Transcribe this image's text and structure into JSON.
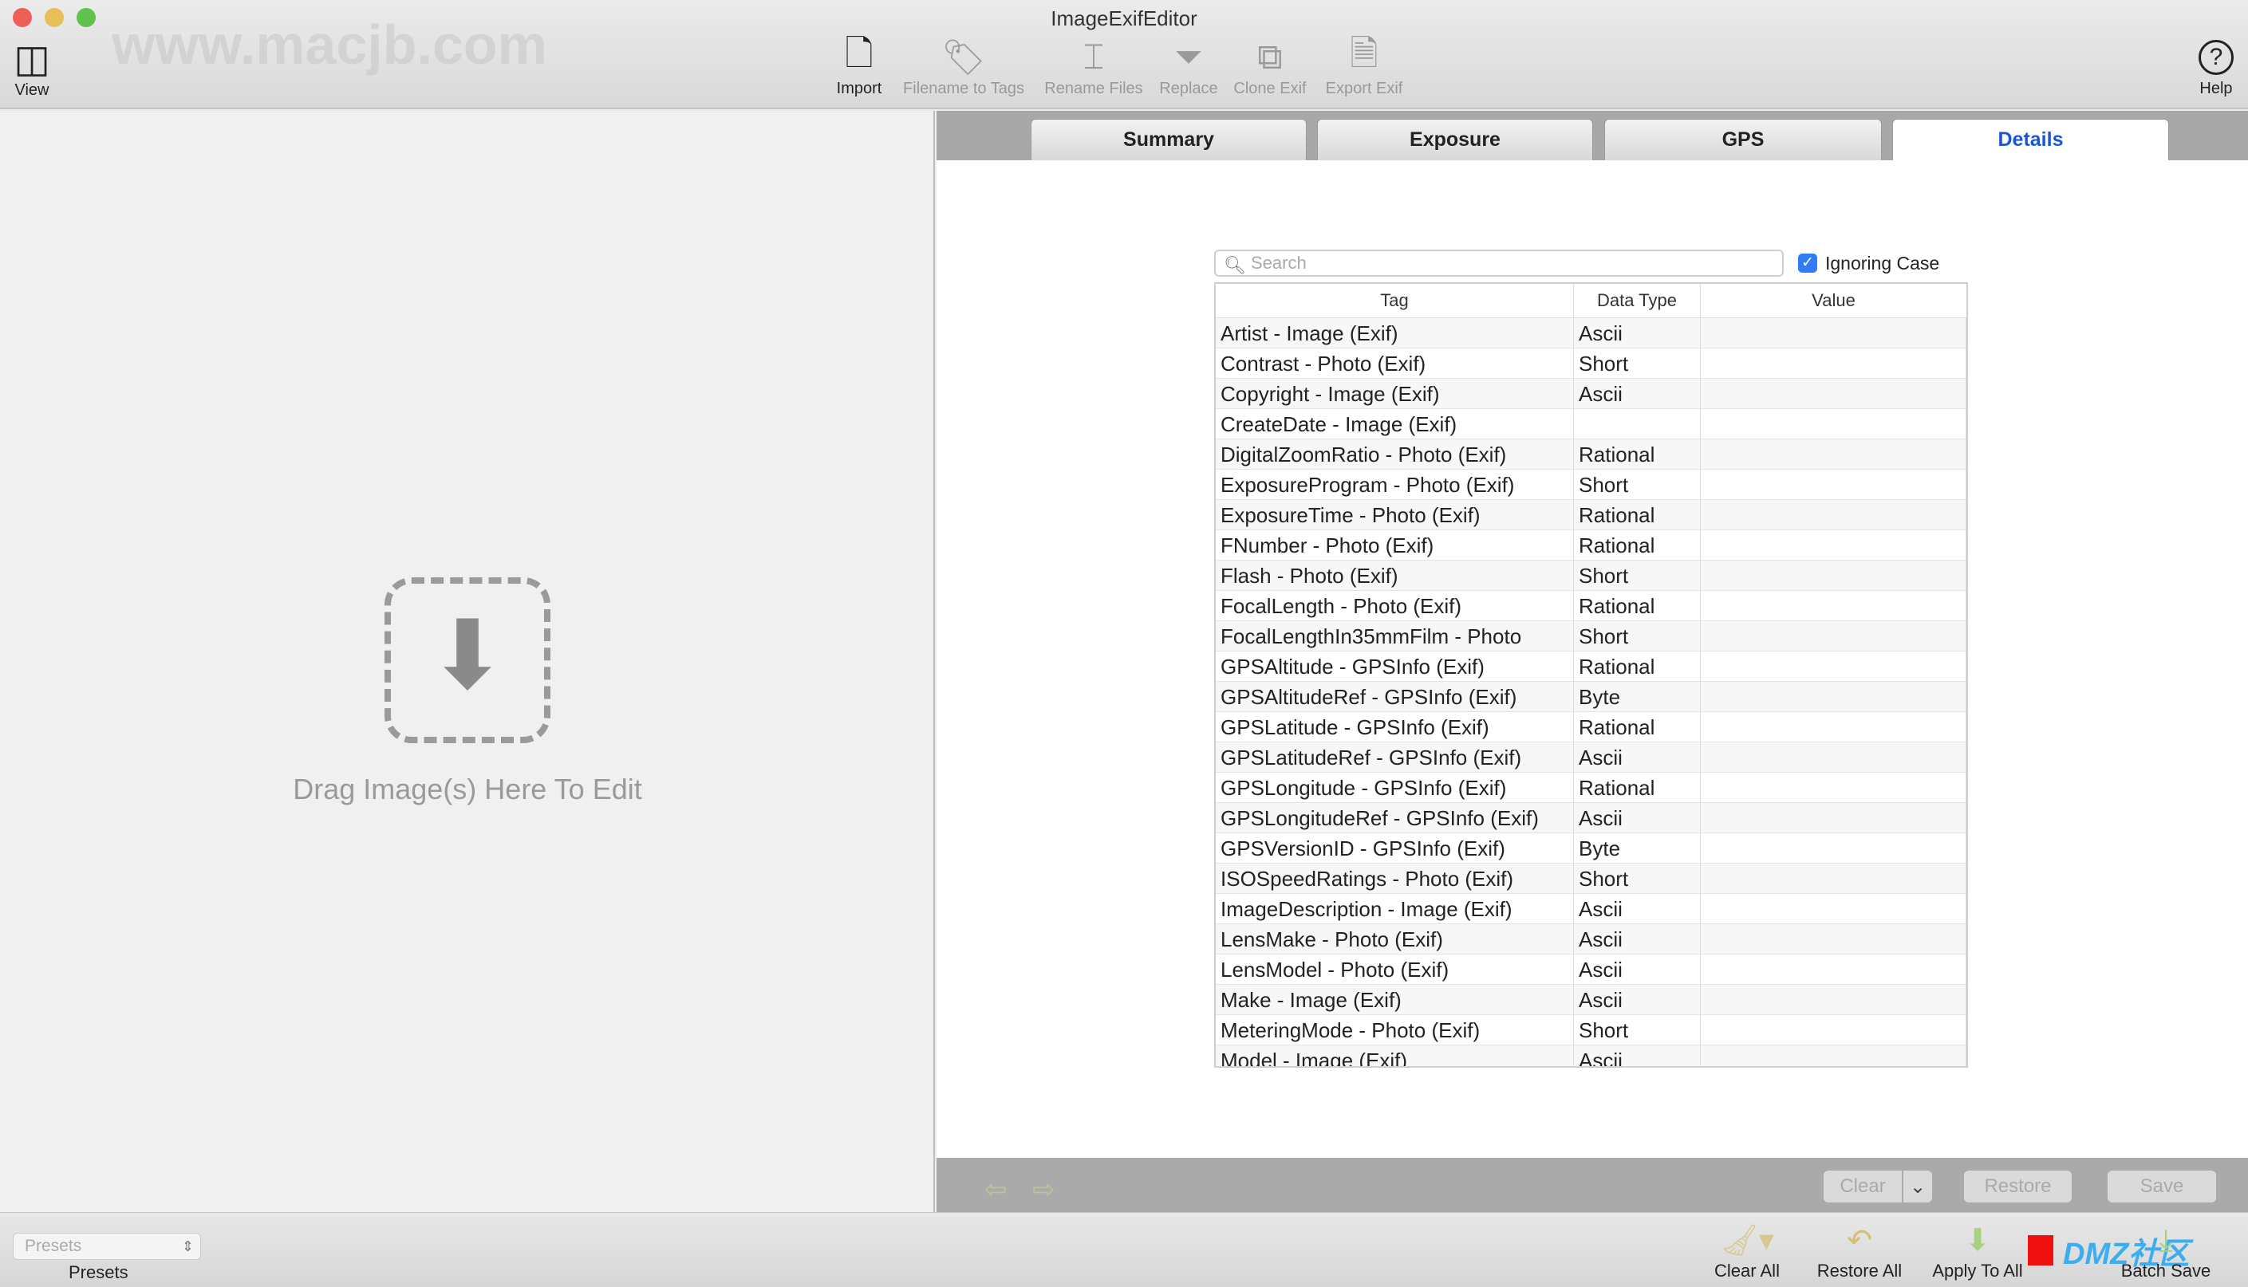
{
  "window": {
    "title": "ImageExifEditor"
  },
  "toolbar": {
    "view": "View",
    "help": "Help",
    "items": [
      {
        "label": "Import",
        "icon": "import-file-icon",
        "enabled": true
      },
      {
        "label": "Filename to Tags",
        "icon": "tag-icon",
        "enabled": false
      },
      {
        "label": "Rename Files",
        "icon": "rename-icon",
        "enabled": false
      },
      {
        "label": "Replace",
        "icon": "funnel-icon",
        "enabled": false
      },
      {
        "label": "Clone Exif",
        "icon": "clone-icon",
        "enabled": false
      },
      {
        "label": "Export Exif",
        "icon": "csv-icon",
        "enabled": false
      }
    ],
    "watermark": "www.macjb.com"
  },
  "left": {
    "drop_text": "Drag Image(s) Here To Edit"
  },
  "tabs": [
    {
      "label": "Summary"
    },
    {
      "label": "Exposure"
    },
    {
      "label": "GPS"
    },
    {
      "label": "Details",
      "active": true
    }
  ],
  "details": {
    "search_placeholder": "Search",
    "ignoring_case_label": "Ignoring Case",
    "ignoring_case_checked": true,
    "columns": [
      "Tag",
      "Data Type",
      "Value"
    ],
    "rows": [
      [
        "Artist - Image (Exif)",
        "Ascii",
        ""
      ],
      [
        "Contrast - Photo (Exif)",
        "Short",
        ""
      ],
      [
        "Copyright - Image (Exif)",
        "Ascii",
        ""
      ],
      [
        "CreateDate - Image (Exif)",
        "",
        ""
      ],
      [
        "DigitalZoomRatio - Photo (Exif)",
        "Rational",
        ""
      ],
      [
        "ExposureProgram - Photo (Exif)",
        "Short",
        ""
      ],
      [
        "ExposureTime - Photo (Exif)",
        "Rational",
        ""
      ],
      [
        "FNumber - Photo (Exif)",
        "Rational",
        ""
      ],
      [
        "Flash - Photo (Exif)",
        "Short",
        ""
      ],
      [
        "FocalLength - Photo (Exif)",
        "Rational",
        ""
      ],
      [
        "FocalLengthIn35mmFilm - Photo",
        "Short",
        ""
      ],
      [
        "GPSAltitude - GPSInfo (Exif)",
        "Rational",
        ""
      ],
      [
        "GPSAltitudeRef - GPSInfo (Exif)",
        "Byte",
        ""
      ],
      [
        "GPSLatitude - GPSInfo (Exif)",
        "Rational",
        ""
      ],
      [
        "GPSLatitudeRef - GPSInfo (Exif)",
        "Ascii",
        ""
      ],
      [
        "GPSLongitude - GPSInfo (Exif)",
        "Rational",
        ""
      ],
      [
        "GPSLongitudeRef - GPSInfo (Exif)",
        "Ascii",
        ""
      ],
      [
        "GPSVersionID - GPSInfo (Exif)",
        "Byte",
        ""
      ],
      [
        "ISOSpeedRatings - Photo (Exif)",
        "Short",
        ""
      ],
      [
        "ImageDescription - Image (Exif)",
        "Ascii",
        ""
      ],
      [
        "LensMake - Photo (Exif)",
        "Ascii",
        ""
      ],
      [
        "LensModel - Photo (Exif)",
        "Ascii",
        ""
      ],
      [
        "Make - Image (Exif)",
        "Ascii",
        ""
      ],
      [
        "MeteringMode - Photo (Exif)",
        "Short",
        ""
      ],
      [
        "Model - Image (Exif)",
        "Ascii",
        ""
      ]
    ]
  },
  "actions": {
    "clear": "Clear",
    "restore": "Restore",
    "save": "Save"
  },
  "bottom": {
    "presets_placeholder": "Presets",
    "presets_label": "Presets",
    "buttons": [
      {
        "label": "Clear All"
      },
      {
        "label": "Restore All"
      },
      {
        "label": "Apply To All"
      },
      {
        "label": "Batch Save"
      }
    ],
    "watermark": "DMZ社区"
  }
}
